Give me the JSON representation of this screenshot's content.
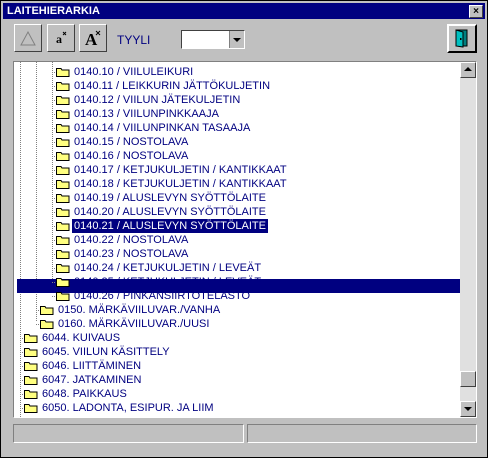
{
  "window": {
    "title": "LAITEHIERARKIA",
    "close_label": "×"
  },
  "toolbar": {
    "style_label": "TYYLI",
    "style_value": "",
    "tools": [
      {
        "name": "draw-line-tool",
        "icon": "triangle-icon"
      },
      {
        "name": "small-font-tool",
        "icon": "font-small-icon"
      },
      {
        "name": "large-font-tool",
        "icon": "font-large-icon"
      }
    ],
    "exit_icon": "door-exit-icon"
  },
  "tree": {
    "items": [
      {
        "label": "0140.10 / VIILULEIKURI",
        "level": 3
      },
      {
        "label": "0140.11 / LEIKKURIN JÄTTÖKULJETIN",
        "level": 3
      },
      {
        "label": "0140.12 / VIILUN JÄTEKULJETIN",
        "level": 3
      },
      {
        "label": "0140.13 / VIILUNPINKKAAJA",
        "level": 3
      },
      {
        "label": "0140.14 / VIILUNPINKAN TASAAJA",
        "level": 3
      },
      {
        "label": "0140.15 / NOSTOLAVA",
        "level": 3
      },
      {
        "label": "0140.16 / NOSTOLAVA",
        "level": 3
      },
      {
        "label": "0140.17 / KETJUKULJETIN / KANTIKKAAT",
        "level": 3
      },
      {
        "label": "0140.18 / KETJUKULJETIN / KANTIKKAAT",
        "level": 3
      },
      {
        "label": "0140.19 / ALUSLEVYN SYÖTTÖLAITE",
        "level": 3
      },
      {
        "label": "0140.20 / ALUSLEVYN SYÖTTÖLAITE",
        "level": 3
      },
      {
        "label": "0140.21 / ALUSLEVYN SYÖTTÖLAITE",
        "level": 3,
        "selected": true
      },
      {
        "label": "0140.22 / NOSTOLAVA",
        "level": 3
      },
      {
        "label": "0140.23 / NOSTOLAVA",
        "level": 3
      },
      {
        "label": "0140.24 / KETJUKULJETIN / LEVEÄT",
        "level": 3
      },
      {
        "label": "0140.25 / KETJUKULJETIN / LEVEÄT",
        "level": 3
      },
      {
        "label": "0140.26 / PINKANSIIRTOTELASTO",
        "level": 3
      },
      {
        "label": "0150. MÄRKÄVIILUVAR./VANHA",
        "level": 2
      },
      {
        "label": "0160. MÄRKÄVIILUVAR./UUSI",
        "level": 2
      },
      {
        "label": "6044. KUIVAUS",
        "level": 1
      },
      {
        "label": "6045. VIILUN KÄSITTELY",
        "level": 1
      },
      {
        "label": "6046. LIITTÄMINEN",
        "level": 1
      },
      {
        "label": "6047. JATKAMINEN",
        "level": 1
      },
      {
        "label": "6048. PAIKKAUS",
        "level": 1
      },
      {
        "label": "6050. LADONTA, ESIPUR. JA LIIM",
        "level": 1
      }
    ]
  },
  "status_bar": {
    "left": "",
    "right": ""
  },
  "colors": {
    "title_bg": "#000080",
    "text": "#000080",
    "folder": "#ffff80",
    "selection": "#000080"
  }
}
